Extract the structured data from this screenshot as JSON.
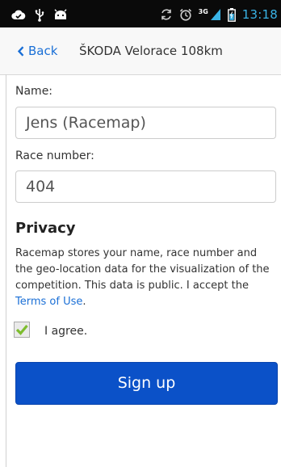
{
  "status_bar": {
    "time": "13:18",
    "network_type": "3G",
    "icons": [
      "cloud-icon",
      "usb-icon",
      "android-debug-icon",
      "sync-icon",
      "alarm-icon",
      "signal-icon",
      "battery-icon"
    ]
  },
  "nav": {
    "back_label": "Back",
    "title": "ŠKODA Velorace 108km"
  },
  "form": {
    "name_label": "Name:",
    "name_value": "Jens (Racemap)",
    "race_number_label": "Race number:",
    "race_number_value": "404"
  },
  "privacy": {
    "heading": "Privacy",
    "text": "Racemap stores your name, race number and the geo-location data for the visualization of the competition. This data is public. I accept the ",
    "terms_link": "Terms of Use",
    "terms_suffix": "."
  },
  "agree": {
    "label": "I agree.",
    "checked": true
  },
  "signup": {
    "label": "Sign up"
  },
  "colors": {
    "accent": "#1a6fd6",
    "button": "#0b51c8",
    "checkmark": "#7dbd2e",
    "clock": "#39b3e6"
  }
}
